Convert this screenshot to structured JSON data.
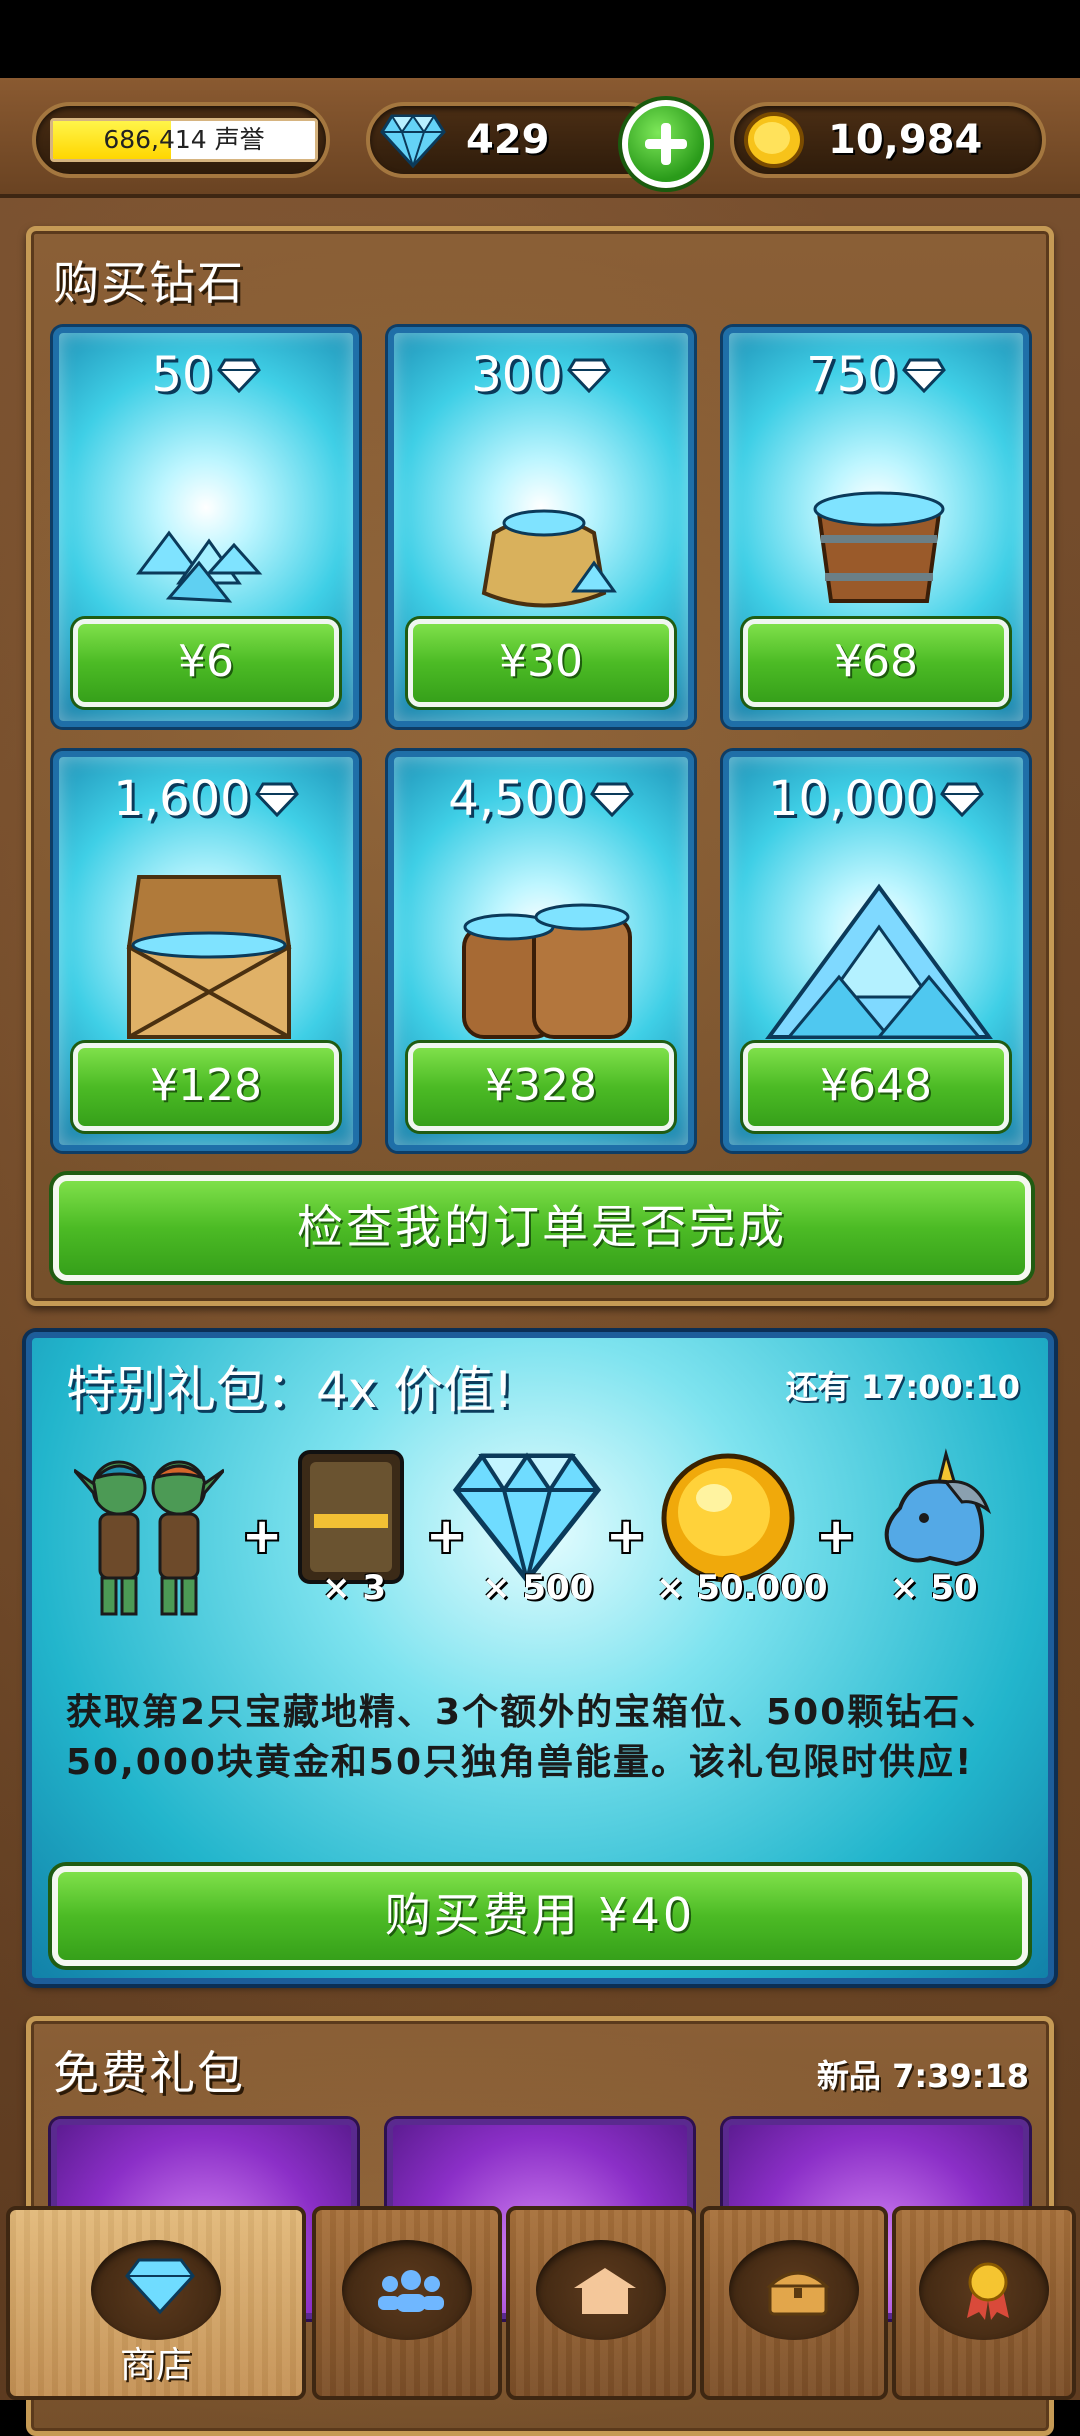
{
  "status_bar": {},
  "topbar": {
    "reputation_value": "686,414",
    "reputation_unit": "声誉",
    "reputation_progress": 0.45,
    "gems": "429",
    "gold": "10,984"
  },
  "shop": {
    "title": "购买钻石",
    "packs": [
      {
        "amount": "50",
        "price": "¥6",
        "icon": "diamond-pile-icon"
      },
      {
        "amount": "300",
        "price": "¥30",
        "icon": "diamond-sack-icon"
      },
      {
        "amount": "750",
        "price": "¥68",
        "icon": "diamond-bucket-icon"
      },
      {
        "amount": "1,600",
        "price": "¥128",
        "icon": "diamond-chest-icon"
      },
      {
        "amount": "4,500",
        "price": "¥328",
        "icon": "diamond-barrels-icon"
      },
      {
        "amount": "10,000",
        "price": "¥648",
        "icon": "diamond-mountain-icon"
      }
    ],
    "check_order_label": "检查我的订单是否完成"
  },
  "special": {
    "title": "特别礼包：4x 价值!",
    "timer": "还有 17:00:10",
    "items": [
      {
        "icon": "goblin-pair-icon",
        "label": ""
      },
      {
        "icon": "treasure-slot-card-icon",
        "label": "× 3"
      },
      {
        "icon": "diamond-icon",
        "label": "× 500"
      },
      {
        "icon": "gold-coin-icon",
        "label": "× 50.000"
      },
      {
        "icon": "unicorn-head-icon",
        "label": "× 50"
      }
    ],
    "description": "获取第2只宝藏地精、3个额外的宝箱位、500颗钻石、50,000块黄金和50只独角兽能量。该礼包限时供应!",
    "buy_label": "购买费用 ¥40"
  },
  "free": {
    "title": "免费礼包",
    "timer": "新品 7:39:18"
  },
  "nav": {
    "tabs": [
      {
        "label": "商店",
        "icon": "shop-diamond-icon",
        "active": true
      },
      {
        "label": "",
        "icon": "friends-icon",
        "active": false
      },
      {
        "label": "",
        "icon": "village-icon",
        "active": false
      },
      {
        "label": "",
        "icon": "treasure-chest-icon",
        "active": false
      },
      {
        "label": "",
        "icon": "medal-icon",
        "active": false
      }
    ]
  },
  "colors": {
    "wood": "#7a5130",
    "green_button": "#4cbb25",
    "card_blue": "#3fcfe6",
    "special_blue": "#22b5cc",
    "free_purple": "#8b2fc7"
  }
}
